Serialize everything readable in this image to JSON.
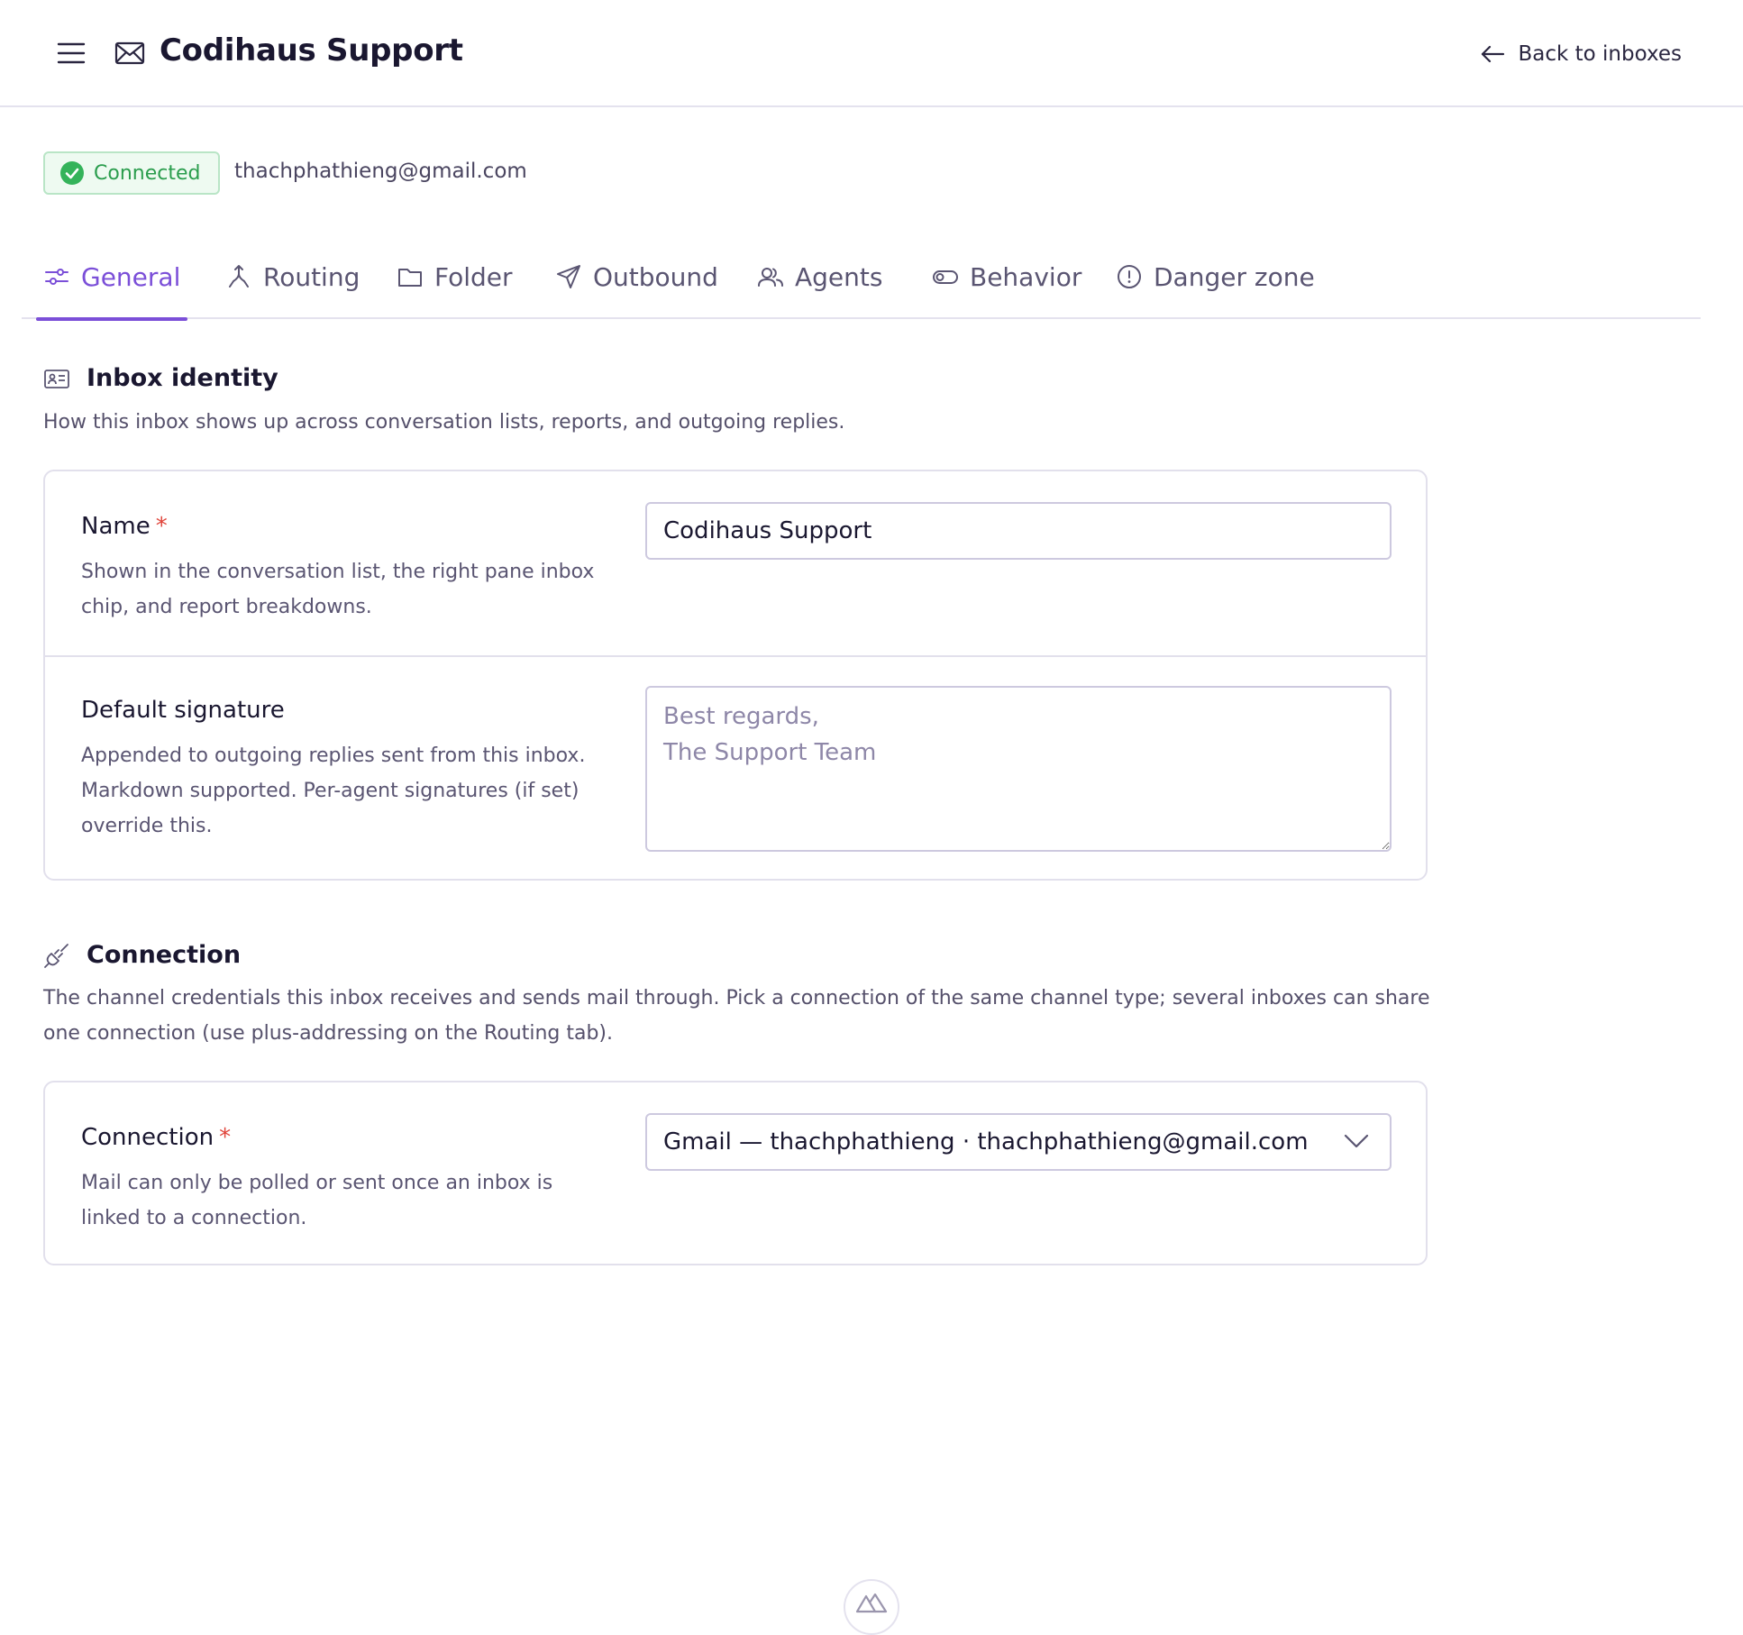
{
  "header": {
    "title": "Codihaus Support",
    "back_label": "Back to inboxes",
    "menu_icon": "hamburger-menu-icon",
    "inbox_icon": "mail-icon"
  },
  "status": {
    "badge_label": "Connected",
    "email": "thachphathieng@gmail.com",
    "color": "#2a9d4d"
  },
  "tabs": [
    {
      "label": "General",
      "icon": "sliders-icon",
      "active": true
    },
    {
      "label": "Routing",
      "icon": "routing-icon",
      "active": false
    },
    {
      "label": "Folder",
      "icon": "folder-icon",
      "active": false
    },
    {
      "label": "Outbound",
      "icon": "send-icon",
      "active": false
    },
    {
      "label": "Agents",
      "icon": "users-icon",
      "active": false
    },
    {
      "label": "Behavior",
      "icon": "toggle-icon",
      "active": false
    },
    {
      "label": "Danger zone",
      "icon": "alert-circle-icon",
      "active": false
    }
  ],
  "identity": {
    "heading": "Inbox identity",
    "description": "How this inbox shows up across conversation lists, reports, and outgoing replies.",
    "name_label": "Name",
    "required_mark": "*",
    "name_help": "Shown in the conversation list, the right pane inbox chip, and report breakdowns.",
    "name_value": "Codihaus Support",
    "signature_label": "Default signature",
    "signature_help": "Appended to outgoing replies sent from this inbox. Markdown supported. Per-agent signatures (if set) override this.",
    "signature_placeholder": "Best regards,\nThe Support Team"
  },
  "connection": {
    "heading": "Connection",
    "description": "The channel credentials this inbox receives and sends mail through. Pick a connection of the same channel type; several inboxes can share one connection (use plus-addressing on the Routing tab).",
    "label": "Connection",
    "required_mark": "*",
    "help": "Mail can only be polled or sent once an inbox is linked to a connection.",
    "selected": "Gmail — thachphathieng · thachphathieng@gmail.com"
  },
  "colors": {
    "accent": "#7b4fd8",
    "success": "#2a9d4d",
    "required": "#e0443a"
  }
}
